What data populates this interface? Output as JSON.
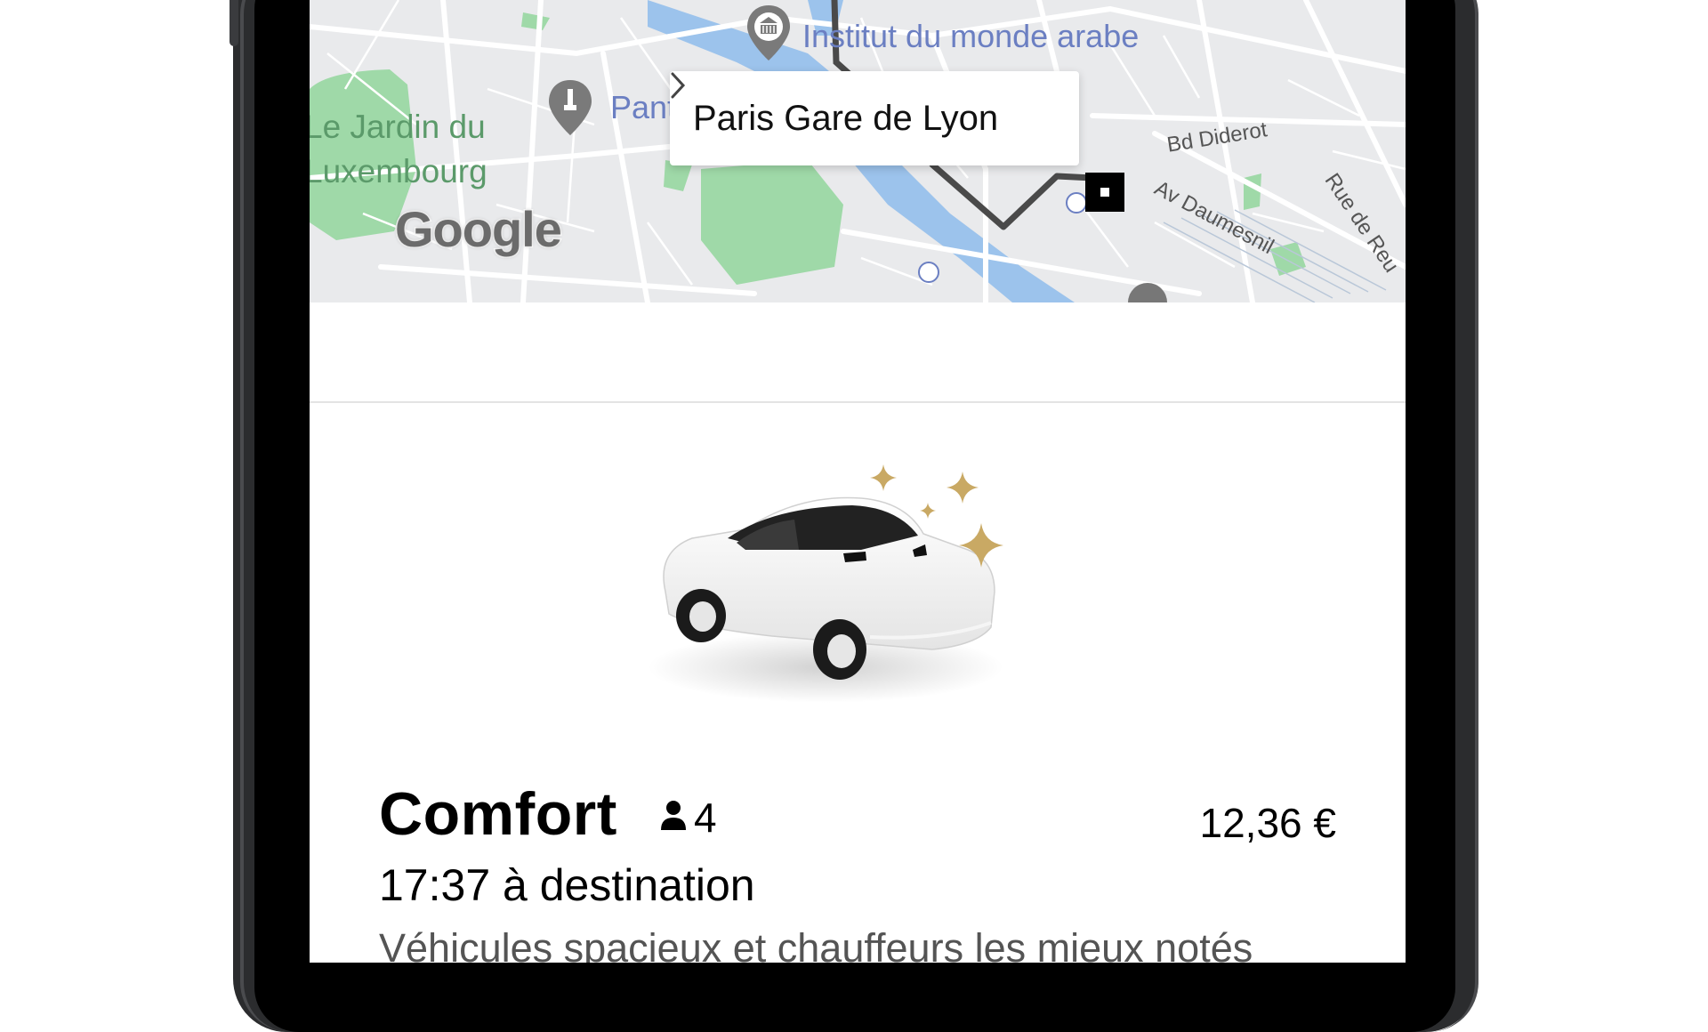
{
  "map": {
    "destination_label": "Paris Gare de Lyon",
    "poi_labels": {
      "institut": "Institut du monde arabe",
      "pantheon": "Pant",
      "park": "Le Jardin du\nLuxembourg"
    },
    "street_labels": {
      "bd_diderot": "Bd Diderot",
      "av_daumesnil": "Av Daumesnil",
      "rue_de_reuilly": "Rue de Reu"
    },
    "attribution": "Google",
    "colors": {
      "land": "#e9eaec",
      "park": "#9fd9a8",
      "water": "#9cc3ec",
      "route": "#4a4a4a",
      "poi": "#6b7fc2"
    }
  },
  "ride": {
    "name": "Comfort",
    "capacity": "4",
    "price": "12,36 €",
    "eta": "17:37 à destination",
    "description": "Véhicules spacieux et chauffeurs les mieux notés"
  },
  "icons": {
    "person": "person-icon",
    "chevron": "chevron-right-icon",
    "car": "car-illustration",
    "sparkle": "sparkle-icon"
  }
}
